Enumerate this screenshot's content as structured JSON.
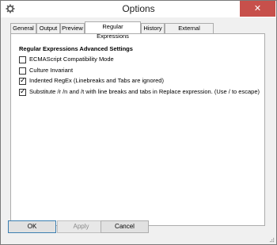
{
  "window": {
    "title": "Options",
    "close_glyph": "✕",
    "icon": "gear-icon"
  },
  "tabs": [
    {
      "label": "General"
    },
    {
      "label": "Output"
    },
    {
      "label": "Preview"
    },
    {
      "label": "Regular Expressions"
    },
    {
      "label": "History"
    },
    {
      "label": "External Programs"
    }
  ],
  "active_tab": "Regular Expressions",
  "panel": {
    "heading": "Regular Expressions Advanced Settings",
    "options": [
      {
        "label": "ECMAScript Compatibility Mode",
        "checked": false
      },
      {
        "label": "Culture Invariant",
        "checked": false
      },
      {
        "label": "Indented RegEx (Linebreaks and Tabs are ignored)",
        "checked": true
      },
      {
        "label": "Substitute /r /n and /t with line breaks and tabs in Replace expression. (Use / to escape)",
        "checked": true
      }
    ]
  },
  "buttons": {
    "ok": "OK",
    "apply": "Apply",
    "cancel": "Cancel"
  },
  "check_glyph": "✓"
}
